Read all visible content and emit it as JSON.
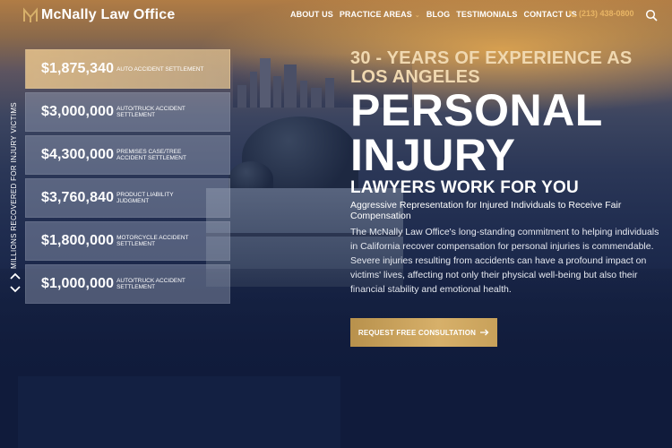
{
  "brand": {
    "name": "McNally Law Office"
  },
  "nav": {
    "items": [
      {
        "label": "ABOUT US"
      },
      {
        "label": "PRACTICE AREAS",
        "has_dropdown": true
      },
      {
        "label": "BLOG"
      },
      {
        "label": "TESTIMONIALS"
      },
      {
        "label": "CONTACT US"
      }
    ],
    "phone": "(213) 438-0800",
    "search_icon": "search-icon"
  },
  "side_rail": {
    "label": "MILLIONS RECOVERED FOR INJURY VICTIMS"
  },
  "settlements": [
    {
      "amount": "$1,875,340",
      "label": "AUTO ACCIDENT SETTLEMENT",
      "highlighted": true
    },
    {
      "amount": "$3,000,000",
      "label": "AUTO/TRUCK ACCIDENT SETTLEMENT"
    },
    {
      "amount": "$4,300,000",
      "label": "PREMISES CASE/TREE ACCIDENT SETTLEMENT"
    },
    {
      "amount": "$3,760,840",
      "label": "PRODUCT LIABILITY JUDGMENT"
    },
    {
      "amount": "$1,800,000",
      "label": "MOTORCYCLE ACCIDENT SETTLEMENT"
    },
    {
      "amount": "$1,000,000",
      "label": "AUTO/TRUCK ACCIDENT SETTLEMENT"
    }
  ],
  "hero": {
    "eyebrow": "30 - YEARS OF EXPERIENCE AS LOS ANGELES",
    "headline_line1": "PERSONAL",
    "headline_line2": "INJURY",
    "subheadline": "LAWYERS WORK FOR YOU",
    "tagline": "Aggressive Representation for Injured Individuals to Receive Fair Compensation",
    "paragraph": "The McNally Law Office's long-standing commitment to helping individuals in California recover compensation for personal injuries is commendable. Severe injuries resulting from accidents can have a profound impact on victims' lives, affecting not only their physical well-being but also their financial stability and emotional health.",
    "cta_label": "REQUEST FREE CONSULTATION"
  },
  "colors": {
    "accent_gold": "#d7b06a",
    "phone_gold": "#e8b565",
    "background_navy": "#0e1a36"
  }
}
